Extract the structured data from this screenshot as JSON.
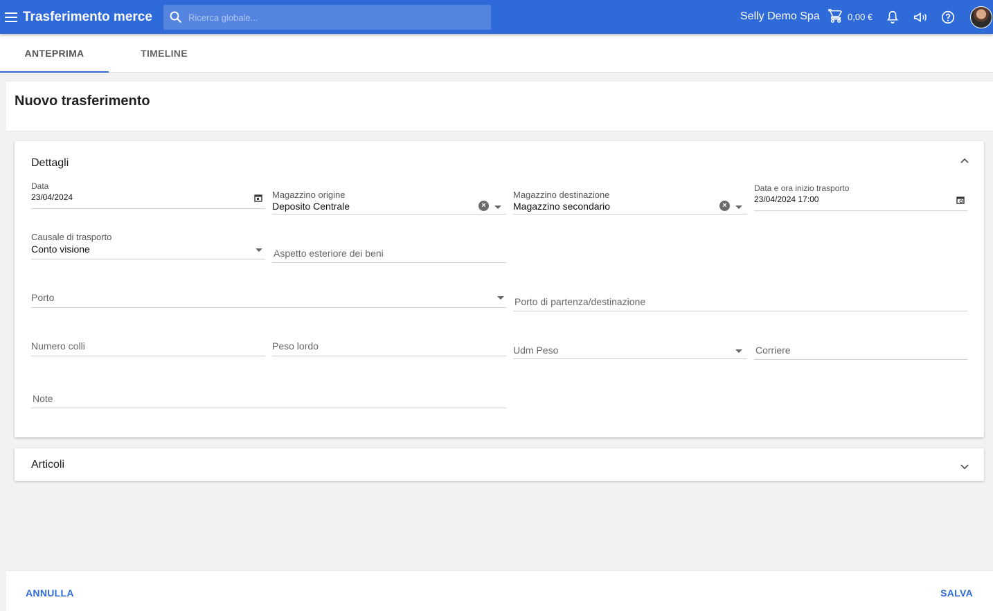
{
  "app": {
    "title": "Trasferimento merce"
  },
  "search": {
    "placeholder": "Ricerca globale..."
  },
  "header": {
    "company": "Selly Demo Spa",
    "cart_amount": "0,00 €"
  },
  "colors": {
    "primary": "#2f6ad9"
  },
  "icons": [
    "menu-icon",
    "search-icon",
    "cart-icon",
    "bell-icon",
    "megaphone-icon",
    "help-icon",
    "calendar-icon",
    "chevron-up-icon",
    "chevron-down-icon",
    "clear-icon"
  ],
  "tabs": [
    {
      "label": "ANTEPRIMA",
      "active": true
    },
    {
      "label": "TIMELINE",
      "active": false
    }
  ],
  "page": {
    "title": "Nuovo trasferimento"
  },
  "details": {
    "title": "Dettagli",
    "data": {
      "label": "Data",
      "value": "23/04/2024"
    },
    "origin": {
      "label": "Magazzino origine",
      "value": "Deposito Centrale"
    },
    "destination": {
      "label": "Magazzino destinazione",
      "value": "Magazzino secondario"
    },
    "transport_start": {
      "label": "Data e ora inizio trasporto",
      "value": "23/04/2024 17:00"
    },
    "reason": {
      "label": "Causale di trasporto",
      "value": "Conto visione"
    },
    "appearance": {
      "label": "Aspetto esteriore dei beni"
    },
    "port": {
      "label": "Porto"
    },
    "port_location": {
      "label": "Porto di partenza/destinazione"
    },
    "packages": {
      "label": "Numero colli"
    },
    "gross_weight": {
      "label": "Peso lordo"
    },
    "weight_uom": {
      "label": "Udm Peso"
    },
    "carrier": {
      "label": "Corriere"
    },
    "notes": {
      "label": "Note"
    }
  },
  "articles": {
    "title": "Articoli"
  },
  "footer": {
    "cancel": "ANNULLA",
    "save": "SALVA"
  }
}
